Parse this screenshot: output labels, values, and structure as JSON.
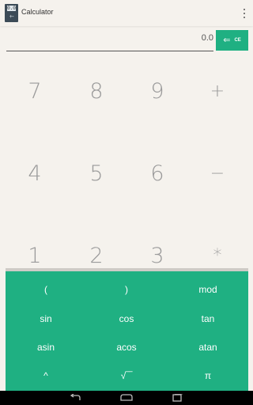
{
  "app": {
    "title": "Calculator",
    "icon_display": "0.0",
    "icon_keys": "+-×="
  },
  "display": {
    "value": "0.0",
    "clear_label": "CE",
    "backspace_icon": "backspace-arrow"
  },
  "numpad": {
    "keys": [
      [
        "7",
        "8",
        "9",
        "+"
      ],
      [
        "4",
        "5",
        "6",
        "−"
      ],
      [
        "1",
        "2",
        "3",
        "*"
      ]
    ]
  },
  "advanced": {
    "keys": [
      [
        "(",
        ")",
        "mod"
      ],
      [
        "sin",
        "cos",
        "tan"
      ],
      [
        "asin",
        "acos",
        "atan"
      ],
      [
        "^",
        "√‾‾",
        "π"
      ]
    ]
  },
  "colors": {
    "accent": "#1fb082",
    "background": "#f5f2ed",
    "navbar": "#000000"
  },
  "navbar": {
    "icons": [
      "back-icon",
      "home-icon",
      "recents-icon"
    ]
  }
}
